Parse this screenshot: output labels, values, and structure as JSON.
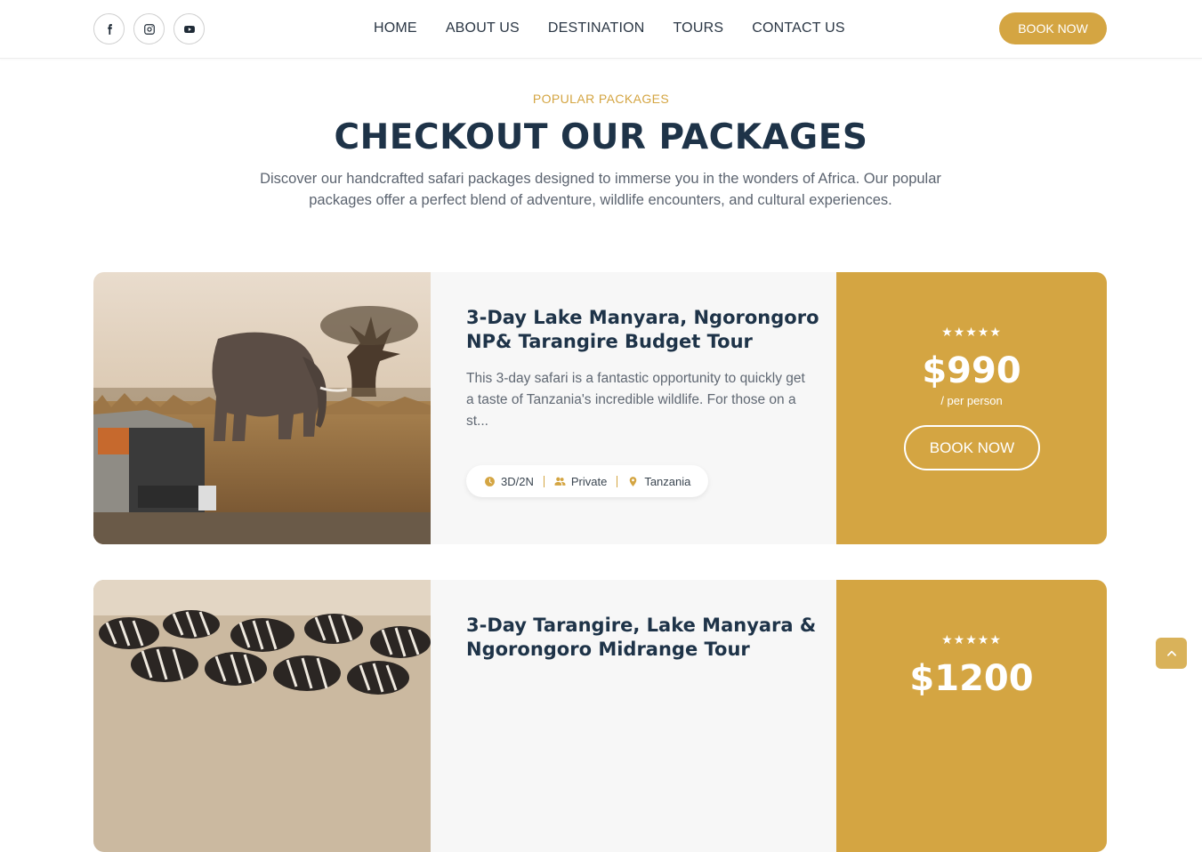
{
  "header": {
    "social": [
      {
        "name": "facebook-icon"
      },
      {
        "name": "instagram-icon"
      },
      {
        "name": "youtube-icon"
      }
    ],
    "nav": [
      "HOME",
      "ABOUT US",
      "DESTINATION",
      "TOURS",
      "CONTACT US"
    ],
    "book_now": "BOOK NOW"
  },
  "section": {
    "eyebrow": "POPULAR PACKAGES",
    "title": "CHECKOUT OUR PACKAGES",
    "intro": "Discover our handcrafted safari packages designed to immerse you in the wonders of Africa. Our popular packages offer a perfect blend of adventure, wildlife encounters, and cultural experiences."
  },
  "packages": [
    {
      "title": "3-Day Lake Manyara, Ngorongoro NP& Tarangire Budget Tour",
      "description": "This 3-day safari is a fantastic opportunity to quickly get a taste of Tanzania's incredible wildlife. For those on a st...",
      "duration": "3D/2N",
      "type": "Private",
      "location": "Tanzania",
      "stars": "★★★★★",
      "price": "$990",
      "per": "/ per person",
      "book": "BOOK NOW",
      "image": "elephant-safari-image"
    },
    {
      "title": "3-Day Tarangire, Lake Manyara & Ngorongoro Midrange Tour",
      "stars": "★★★★★",
      "price": "$1200",
      "image": "zebra-herd-image"
    }
  ],
  "colors": {
    "accent": "#d4a542",
    "heading": "#1e3348",
    "text": "#5c6470",
    "card_bg": "#f7f7f7"
  }
}
